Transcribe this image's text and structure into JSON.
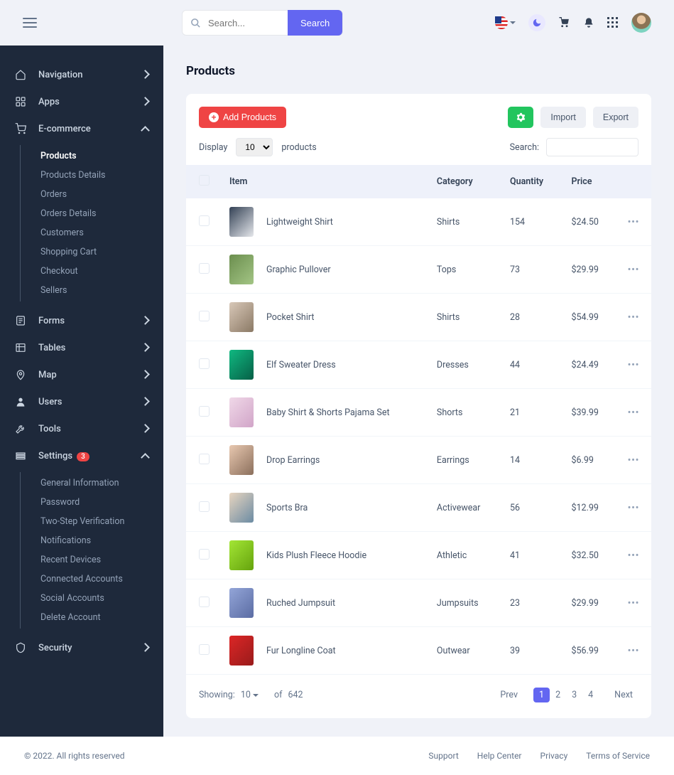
{
  "header": {
    "search_placeholder": "Search...",
    "search_button": "Search"
  },
  "sidebar": {
    "items": [
      {
        "label": "Navigation"
      },
      {
        "label": "Apps"
      },
      {
        "label": "E-commerce"
      },
      {
        "label": "Forms"
      },
      {
        "label": "Tables"
      },
      {
        "label": "Map"
      },
      {
        "label": "Users"
      },
      {
        "label": "Tools"
      },
      {
        "label": "Settings",
        "badge": "3"
      },
      {
        "label": "Security"
      }
    ],
    "ecommerce_sub": [
      {
        "label": "Products"
      },
      {
        "label": "Products Details"
      },
      {
        "label": "Orders"
      },
      {
        "label": "Orders Details"
      },
      {
        "label": "Customers"
      },
      {
        "label": "Shopping Cart"
      },
      {
        "label": "Checkout"
      },
      {
        "label": "Sellers"
      }
    ],
    "settings_sub": [
      {
        "label": "General Information"
      },
      {
        "label": "Password"
      },
      {
        "label": "Two-Step Verification"
      },
      {
        "label": "Notifications"
      },
      {
        "label": "Recent Devices"
      },
      {
        "label": "Connected Accounts"
      },
      {
        "label": "Social Accounts"
      },
      {
        "label": "Delete Account"
      }
    ]
  },
  "page": {
    "title": "Products",
    "add_btn": "Add Products",
    "import_btn": "Import",
    "export_btn": "Export",
    "display_label": "Display",
    "display_value": "10",
    "display_suffix": "products",
    "search_label": "Search:"
  },
  "table": {
    "columns": [
      "Item",
      "Category",
      "Quantity",
      "Price"
    ],
    "rows": [
      {
        "name": "Lightweight Shirt",
        "category": "Shirts",
        "qty": "154",
        "price": "$24.50",
        "thumb": "#334155,#e5e7eb"
      },
      {
        "name": "Graphic Pullover",
        "category": "Tops",
        "qty": "73",
        "price": "$29.99",
        "thumb": "#6b8e4e,#a3c585"
      },
      {
        "name": "Pocket Shirt",
        "category": "Shirts",
        "qty": "28",
        "price": "$54.99",
        "thumb": "#d8c8b8,#8b7965"
      },
      {
        "name": "Elf Sweater Dress",
        "category": "Dresses",
        "qty": "44",
        "price": "$24.49",
        "thumb": "#10b981,#065f46"
      },
      {
        "name": "Baby Shirt & Shorts Pajama Set",
        "category": "Shorts",
        "qty": "21",
        "price": "$39.99",
        "thumb": "#f0d8e8,#d1a5c8"
      },
      {
        "name": "Drop Earrings",
        "category": "Earrings",
        "qty": "14",
        "price": "$6.99",
        "thumb": "#e8c8b0,#8b6f5c"
      },
      {
        "name": "Sports Bra",
        "category": "Activewear",
        "qty": "56",
        "price": "$12.99",
        "thumb": "#e8d5c0,#6b8ba3"
      },
      {
        "name": "Kids Plush Fleece Hoodie",
        "category": "Athletic",
        "qty": "41",
        "price": "$32.50",
        "thumb": "#a3e635,#65a30d"
      },
      {
        "name": "Ruched Jumpsuit",
        "category": "Jumpsuits",
        "qty": "23",
        "price": "$29.99",
        "thumb": "#93a5d8,#5b6ca3"
      },
      {
        "name": "Fur Longline Coat",
        "category": "Outwear",
        "qty": "39",
        "price": "$56.99",
        "thumb": "#dc2626,#991b1b"
      }
    ]
  },
  "pager": {
    "showing": "Showing:",
    "showing_val": "10",
    "of": "of",
    "total": "642",
    "prev": "Prev",
    "pages": [
      "1",
      "2",
      "3",
      "4"
    ],
    "next": "Next"
  },
  "footer": {
    "copyright": "2022. All rights reserved",
    "links": [
      "Support",
      "Help Center",
      "Privacy",
      "Terms of Service"
    ]
  }
}
